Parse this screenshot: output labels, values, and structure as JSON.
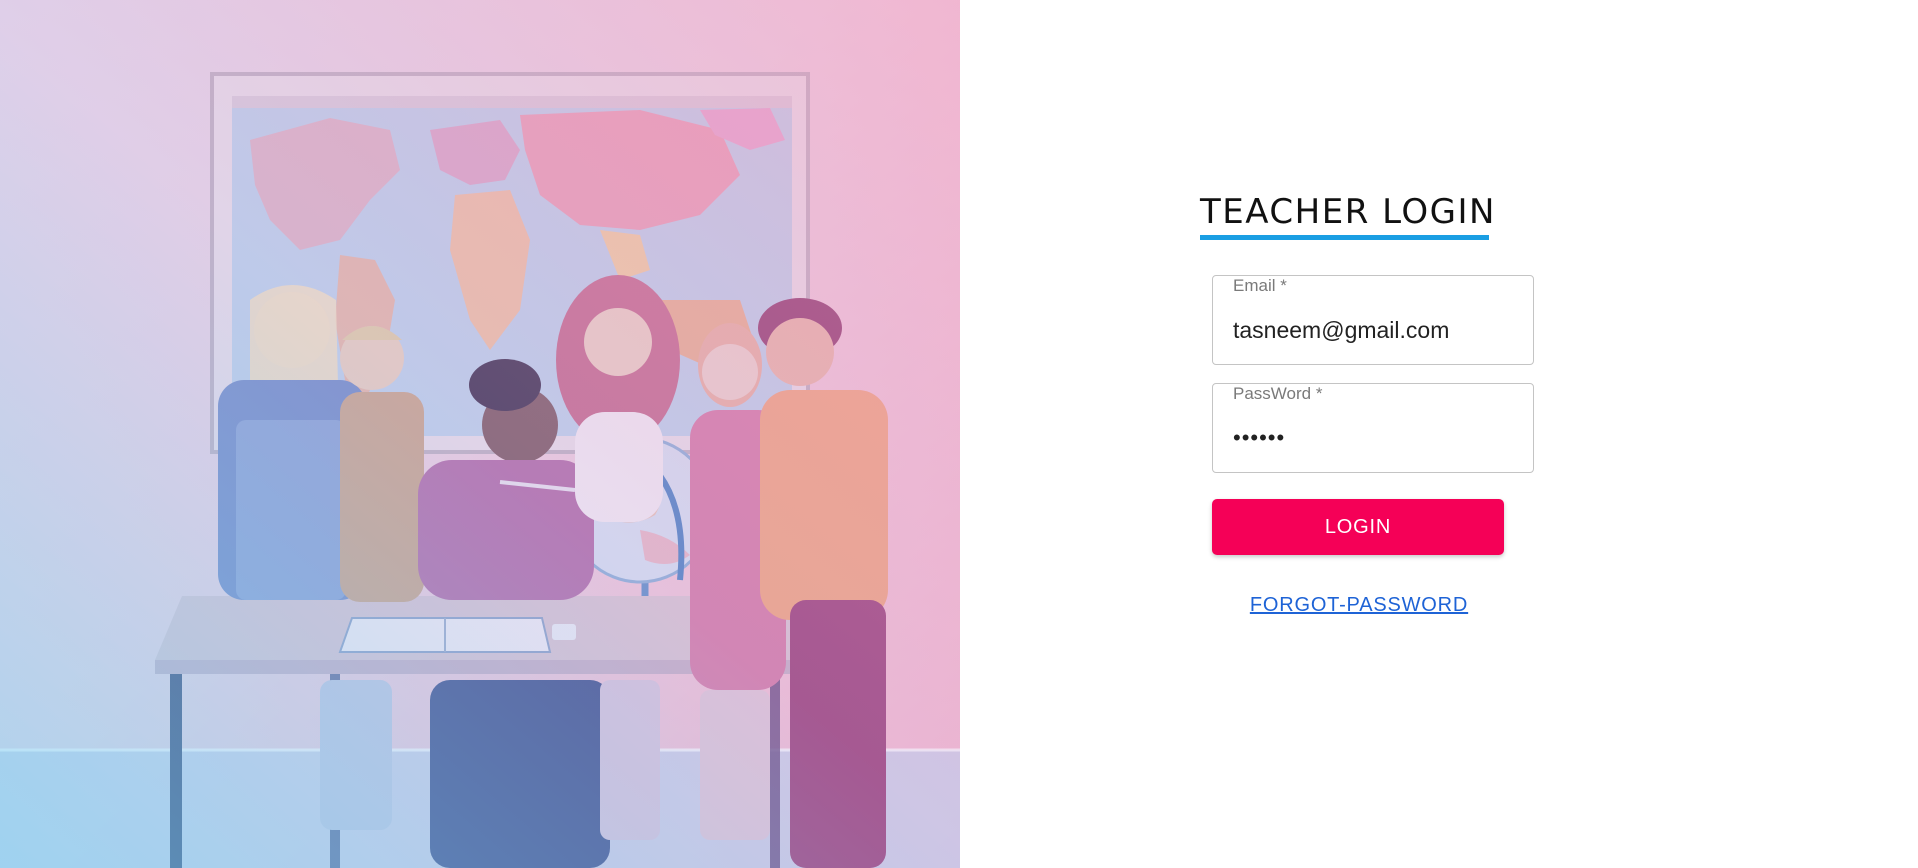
{
  "hero": {
    "image": "teacher-with-students-around-globe-illustration"
  },
  "login": {
    "title": "TEACHER LOGIN",
    "email": {
      "label": "Email *",
      "value": "tasneem@gmail.com"
    },
    "password": {
      "label": "PassWord *",
      "value": "••••••"
    },
    "button_label": "LOGIN",
    "forgot_label": "FORGOT-PASSWORD"
  },
  "colors": {
    "accent_underline": "#1a9ee3",
    "button": "#f50057",
    "link": "#1e63d6"
  }
}
